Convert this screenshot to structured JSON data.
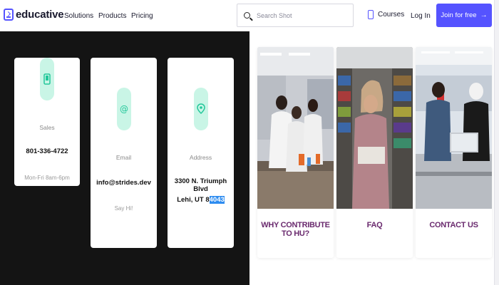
{
  "navbar": {
    "logo_text": "educative",
    "links": [
      "Solutions",
      "Products",
      "Pricing"
    ],
    "search_placeholder": "Search Shot",
    "courses_label": "Courses",
    "login_label": "Log In",
    "join_label": "Join for free",
    "join_arrow": "→",
    "accent_color": "#5553ff"
  },
  "contact_cards": [
    {
      "icon": "phone-icon",
      "label": "Sales",
      "value": "801-336-4722",
      "sub": "Mon-Fri 8am-6pm"
    },
    {
      "icon": "at-icon",
      "label": "Email",
      "value": "info@strides.dev",
      "sub": "Say Hi!"
    },
    {
      "icon": "location-pin-icon",
      "label": "Address",
      "value_line1": "3300 N. Triumph Blvd",
      "value_line2_plain": "Lehi, UT 8",
      "value_line2_highlight": "4043"
    }
  ],
  "photo_cards": [
    {
      "label": "WHY CONTRIBUTE TO HU?",
      "image": "lab-students-photo"
    },
    {
      "label": "FAQ",
      "image": "library-reader-photo"
    },
    {
      "label": "CONTACT US",
      "image": "students-laptop-photo"
    }
  ]
}
